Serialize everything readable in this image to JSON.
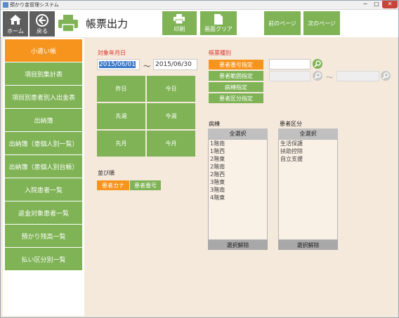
{
  "window": {
    "title": "預かり金管理システム",
    "min": "−",
    "max": "□",
    "close": "✕"
  },
  "toolbar": {
    "home_label": "ホーム",
    "back_label": "戻る",
    "page_title": "帳票出力",
    "print_label": "印刷",
    "clear_label": "画面クリア",
    "prev_label": "前のページ",
    "next_label": "次のページ"
  },
  "sidebar": {
    "items": [
      {
        "label": "小遣い帳",
        "active": true
      },
      {
        "label": "項目別集計表"
      },
      {
        "label": "項目別患者別入出金表"
      },
      {
        "label": "出納簿"
      },
      {
        "label": "出納簿（患個人別一覧）"
      },
      {
        "label": "出納簿（患個人別台帳）"
      },
      {
        "label": "入院患者一覧"
      },
      {
        "label": "返金対象患者一覧"
      },
      {
        "label": "預かり残高一覧"
      },
      {
        "label": "払い区分別一覧"
      }
    ]
  },
  "date_section": {
    "label": "対象年月日",
    "from": "2015/06/01",
    "to": "2015/06/30",
    "tilde": "～",
    "quick": [
      "昨日",
      "今日",
      "先週",
      "今週",
      "先月",
      "今月"
    ]
  },
  "sort_section": {
    "label": "並び順",
    "options": [
      "患者カナ",
      "患者番号"
    ]
  },
  "report_type": {
    "label": "帳票種別",
    "options": [
      "患者番号指定",
      "患者範囲指定",
      "病棟指定",
      "患者区分指定"
    ],
    "tilde": "～"
  },
  "ward": {
    "label": "病棟",
    "select_all": "全選択",
    "clear": "選択解除",
    "items": [
      "1階南",
      "1階西",
      "2階東",
      "2階南",
      "2階西",
      "3階東",
      "3階南",
      "4階東"
    ]
  },
  "patient_class": {
    "label": "患者区分",
    "select_all": "全選択",
    "clear": "選択解除",
    "items": [
      "生活保護",
      "扶助控除",
      "自立支援"
    ]
  },
  "colors": {
    "green": "#7fb356",
    "orange": "#f7941d",
    "title_red": "#d9382b",
    "panel": "#f5e9dc"
  }
}
